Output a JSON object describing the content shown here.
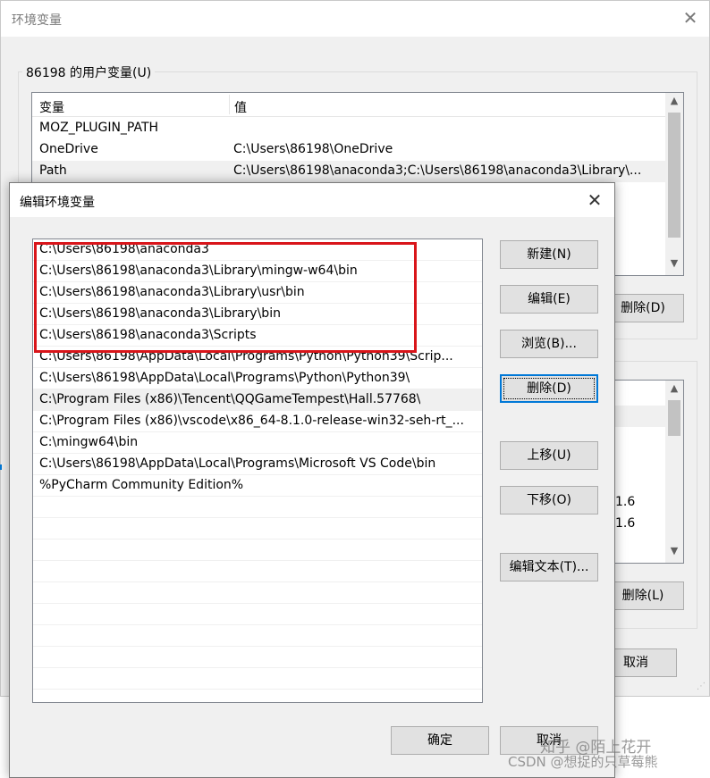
{
  "background_window": {
    "title": "环境变量",
    "user_vars_group": "86198 的用户变量(U)",
    "columns": {
      "name": "变量",
      "value": "值"
    },
    "rows": [
      {
        "name": "MOZ_PLUGIN_PATH",
        "value": ""
      },
      {
        "name": "OneDrive",
        "value": "C:\\Users\\86198\\OneDrive"
      },
      {
        "name": "Path",
        "value": "C:\\Users\\86198\\anaconda3;C:\\Users\\86198\\anaconda3\\Library\\..."
      }
    ],
    "delete_user_button": "删除(D)",
    "system_values": [
      "1.6",
      "1.6"
    ],
    "delete_sys_button": "删除(L)",
    "cancel_button": "取消"
  },
  "dialog": {
    "title": "编辑环境变量",
    "paths": [
      "C:\\Users\\86198\\anaconda3",
      "C:\\Users\\86198\\anaconda3\\Library\\mingw-w64\\bin",
      "C:\\Users\\86198\\anaconda3\\Library\\usr\\bin",
      "C:\\Users\\86198\\anaconda3\\Library\\bin",
      "C:\\Users\\86198\\anaconda3\\Scripts",
      "C:\\Users\\86198\\AppData\\Local\\Programs\\Python\\Python39\\Scrip...",
      "C:\\Users\\86198\\AppData\\Local\\Programs\\Python\\Python39\\",
      "C:\\Program Files (x86)\\Tencent\\QQGameTempest\\Hall.57768\\",
      "C:\\Program Files (x86)\\vscode\\x86_64-8.1.0-release-win32-seh-rt_...",
      "C:\\mingw64\\bin",
      "C:\\Users\\86198\\AppData\\Local\\Programs\\Microsoft VS Code\\bin",
      "%PyCharm Community Edition%"
    ],
    "selected_index": 7,
    "buttons": {
      "new": "新建(N)",
      "edit": "编辑(E)",
      "browse": "浏览(B)...",
      "delete": "删除(D)",
      "move_up": "上移(U)",
      "move_down": "下移(O)",
      "edit_text": "编辑文本(T)...",
      "ok": "确定",
      "cancel": "取消"
    },
    "highlight_color": "#d9151a"
  },
  "watermarks": {
    "zhihu": "知乎 @陌上花开",
    "csdn": "CSDN @想捉的只草莓熊"
  },
  "colors": {
    "accent": "#0078d7",
    "dialog_bg": "#f0f0f0",
    "button_bg": "#e1e1e1"
  },
  "icons": [
    "close-icon",
    "scroll-up-icon",
    "scroll-down-icon"
  ]
}
